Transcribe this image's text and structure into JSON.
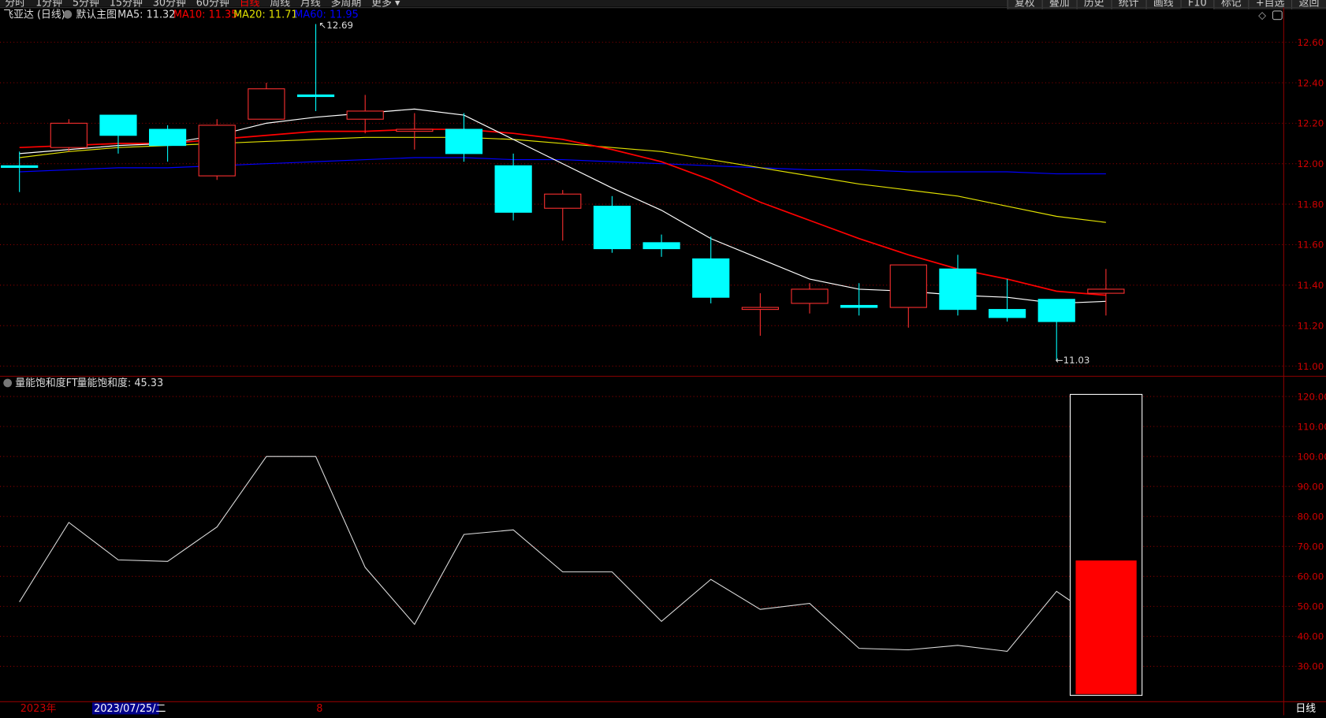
{
  "menu": {
    "left": [
      "分时",
      "1分钟",
      "5分钟",
      "15分钟",
      "30分钟",
      "60分钟",
      "日线",
      "周线",
      "月线",
      "多周期",
      "更多 ▾"
    ],
    "active": "日线",
    "right": [
      "复权",
      "叠加",
      "历史",
      "统计",
      "画线",
      "F10",
      "标记",
      "+自选",
      "返回"
    ]
  },
  "header": {
    "title": "飞亚达 (日线)",
    "template": "默认主图",
    "ma5": "MA5: 11.32",
    "ma10": "MA10: 11.35",
    "ma20": "MA20: 11.71",
    "ma60": "MA60: 11.95"
  },
  "colors": {
    "up": "#ff3030",
    "down": "#00ffff",
    "ma5": "#ffffff",
    "ma10": "#ff0000",
    "ma20": "#e0e000",
    "ma60": "#0000ff",
    "grid": "#8b0000"
  },
  "price_axis": [
    "12.60",
    "12.40",
    "12.20",
    "12.00",
    "11.80",
    "11.60",
    "11.40",
    "11.20",
    "11.00"
  ],
  "annotations": {
    "high": "12.69",
    "low": "11.03"
  },
  "candles": [
    [
      11.99,
      12.06,
      11.86,
      11.99
    ],
    [
      12.08,
      12.22,
      12.06,
      12.2
    ],
    [
      12.24,
      12.24,
      12.05,
      12.14
    ],
    [
      12.17,
      12.19,
      12.01,
      12.09
    ],
    [
      11.94,
      12.22,
      11.92,
      12.19
    ],
    [
      12.22,
      12.4,
      12.22,
      12.37
    ],
    [
      12.34,
      12.69,
      12.26,
      12.34
    ],
    [
      12.22,
      12.34,
      12.15,
      12.26
    ],
    [
      12.16,
      12.25,
      12.07,
      12.17
    ],
    [
      12.17,
      12.25,
      12.01,
      12.05
    ],
    [
      11.99,
      12.05,
      11.72,
      11.76
    ],
    [
      11.78,
      11.87,
      11.62,
      11.85
    ],
    [
      11.79,
      11.84,
      11.56,
      11.58
    ],
    [
      11.61,
      11.65,
      11.54,
      11.58
    ],
    [
      11.53,
      11.64,
      11.31,
      11.34
    ],
    [
      11.28,
      11.36,
      11.15,
      11.29
    ],
    [
      11.31,
      11.41,
      11.26,
      11.38
    ],
    [
      11.3,
      11.41,
      11.25,
      11.29
    ],
    [
      11.29,
      11.5,
      11.19,
      11.5
    ],
    [
      11.48,
      11.55,
      11.25,
      11.28
    ],
    [
      11.28,
      11.43,
      11.22,
      11.24
    ],
    [
      11.33,
      11.33,
      11.03,
      11.22
    ],
    [
      11.36,
      11.48,
      11.25,
      11.38
    ]
  ],
  "ma": {
    "ma5": [
      12.05,
      12.07,
      12.09,
      12.1,
      12.14,
      12.2,
      12.23,
      12.25,
      12.27,
      12.24,
      12.12,
      12.0,
      11.88,
      11.77,
      11.63,
      11.53,
      11.43,
      11.38,
      11.37,
      11.35,
      11.34,
      11.31,
      11.32
    ],
    "ma10": [
      12.08,
      12.09,
      12.1,
      12.1,
      12.12,
      12.14,
      12.16,
      12.16,
      12.17,
      12.17,
      12.15,
      12.12,
      12.07,
      12.01,
      11.92,
      11.81,
      11.72,
      11.63,
      11.55,
      11.48,
      11.43,
      11.37,
      11.35
    ],
    "ma20": [
      12.03,
      12.06,
      12.08,
      12.09,
      12.1,
      12.11,
      12.12,
      12.13,
      12.13,
      12.13,
      12.12,
      12.1,
      12.08,
      12.06,
      12.02,
      11.98,
      11.94,
      11.9,
      11.87,
      11.84,
      11.79,
      11.74,
      11.71
    ],
    "ma60": [
      11.96,
      11.97,
      11.98,
      11.98,
      11.99,
      12.0,
      12.01,
      12.02,
      12.03,
      12.03,
      12.02,
      12.02,
      12.01,
      12.0,
      11.99,
      11.98,
      11.97,
      11.97,
      11.96,
      11.96,
      11.96,
      11.95,
      11.95
    ]
  },
  "indicator": {
    "title": "量能饱和度FT",
    "label": "量能饱和度: 45.33",
    "axis": [
      "120.00",
      "110.00",
      "100.00",
      "90.00",
      "80.00",
      "70.00",
      "60.00",
      "50.00",
      "40.00",
      "30.00"
    ],
    "values": [
      51.5,
      78,
      65.5,
      65,
      76.5,
      100,
      100,
      63,
      44,
      74,
      75.5,
      61.5,
      61.5,
      45,
      59,
      49,
      51,
      36,
      35.5,
      37,
      35,
      55
    ],
    "bar_value": 65.3
  },
  "time_axis": {
    "year": "2023年",
    "cursor": "2023/07/25/二",
    "month": "8",
    "period": "日线"
  }
}
